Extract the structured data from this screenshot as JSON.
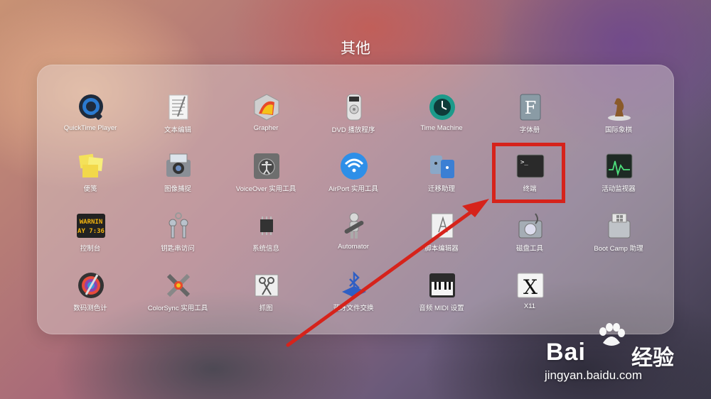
{
  "folder": {
    "title": "其他",
    "apps": [
      {
        "label": "QuickTime Player",
        "icon": "quicktime-icon"
      },
      {
        "label": "文本编辑",
        "icon": "textedit-icon"
      },
      {
        "label": "Grapher",
        "icon": "grapher-icon"
      },
      {
        "label": "DVD 播放程序",
        "icon": "dvd-player-icon"
      },
      {
        "label": "Time Machine",
        "icon": "time-machine-icon"
      },
      {
        "label": "字体册",
        "icon": "font-book-icon"
      },
      {
        "label": "国际象棋",
        "icon": "chess-icon"
      },
      {
        "label": "便笺",
        "icon": "stickies-icon"
      },
      {
        "label": "图像捕捉",
        "icon": "image-capture-icon"
      },
      {
        "label": "VoiceOver 实用工具",
        "icon": "voiceover-icon"
      },
      {
        "label": "AirPort 实用工具",
        "icon": "airport-icon"
      },
      {
        "label": "迁移助理",
        "icon": "migration-assistant-icon"
      },
      {
        "label": "终端",
        "icon": "terminal-icon"
      },
      {
        "label": "活动监视器",
        "icon": "activity-monitor-icon"
      },
      {
        "label": "控制台",
        "icon": "console-icon",
        "icon_text": [
          "WARNIN",
          "AY 7:36"
        ]
      },
      {
        "label": "钥匙串访问",
        "icon": "keychain-icon"
      },
      {
        "label": "系统信息",
        "icon": "system-information-icon"
      },
      {
        "label": "Automator",
        "icon": "automator-icon"
      },
      {
        "label": "脚本编辑器",
        "icon": "script-editor-icon"
      },
      {
        "label": "磁盘工具",
        "icon": "disk-utility-icon"
      },
      {
        "label": "Boot Camp 助理",
        "icon": "boot-camp-icon"
      },
      {
        "label": "数码测色计",
        "icon": "digital-color-meter-icon"
      },
      {
        "label": "ColorSync 实用工具",
        "icon": "colorsync-icon"
      },
      {
        "label": "抓图",
        "icon": "grab-icon"
      },
      {
        "label": "蓝牙文件交换",
        "icon": "bluetooth-icon"
      },
      {
        "label": "音频 MIDI 设置",
        "icon": "audio-midi-icon"
      },
      {
        "label": "X11",
        "icon": "x11-icon"
      }
    ]
  },
  "annotation": {
    "highlight_color": "#d6231b",
    "target": "终端"
  },
  "watermark": {
    "brand": "Bai",
    "brand_suffix": "经验",
    "url": "jingyan.baidu.com"
  }
}
